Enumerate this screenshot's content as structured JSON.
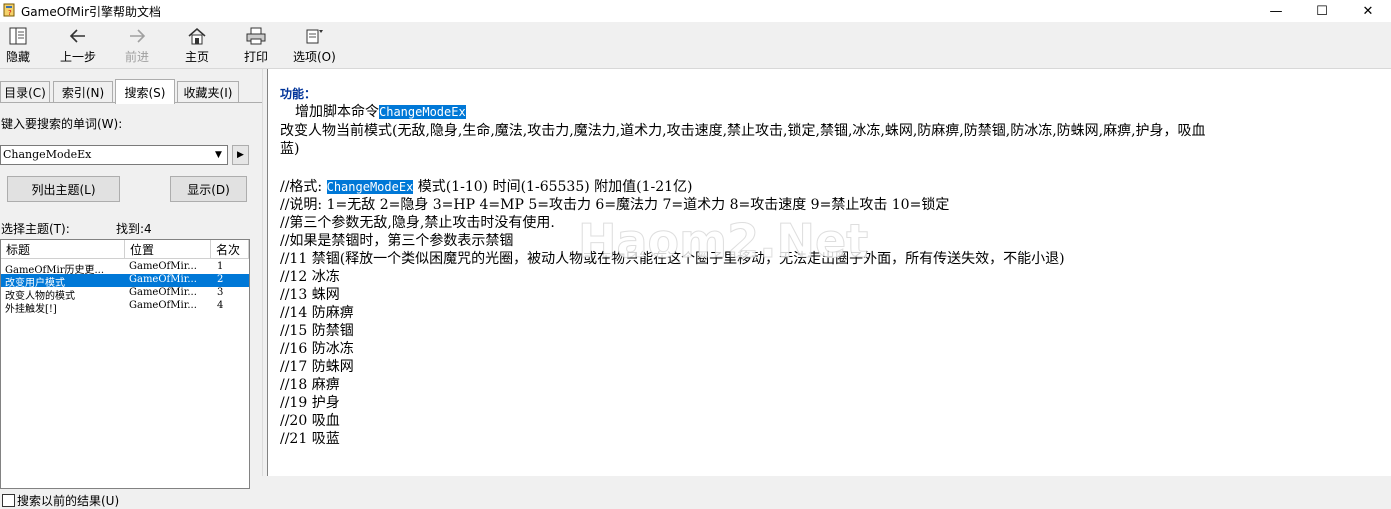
{
  "window": {
    "title": "GameOfMir引擎帮助文档",
    "min": "—",
    "max": "☐",
    "close": "✕"
  },
  "toolbar": {
    "hide": "隐藏",
    "back": "上一步",
    "forward": "前进",
    "home": "主页",
    "print": "打印",
    "options": "选项(O)"
  },
  "tabs": [
    {
      "label": "目录(C)"
    },
    {
      "label": "索引(N)"
    },
    {
      "label": "搜索(S)"
    },
    {
      "label": "收藏夹(I)"
    }
  ],
  "search": {
    "prompt": "键入要搜索的单词(W):",
    "value": "ChangeModeEx",
    "list_topics_button": "列出主题(L)",
    "display_button": "显示(D)",
    "select_topic_label": "选择主题(T):",
    "found_label": "找到:4",
    "columns": [
      "标题",
      "位置",
      "名次"
    ],
    "results": [
      {
        "title": "GameOfMir历史更...",
        "location": "GameOfMir...",
        "rank": "1",
        "selected": false
      },
      {
        "title": "改变用户模式",
        "location": "GameOfMir...",
        "rank": "2",
        "selected": true
      },
      {
        "title": "改变人物的模式",
        "location": "GameOfMir...",
        "rank": "3",
        "selected": false
      },
      {
        "title": "外挂触发[!]",
        "location": "GameOfMir...",
        "rank": "4",
        "selected": false
      }
    ],
    "search_previous_label": "搜索以前的结果(U)"
  },
  "content": {
    "heading": "功能：",
    "intro_prefix": "增加脚本命令",
    "keyword": "ChangeModeEx",
    "desc_line1": "改变人物当前模式(无敌,隐身,生命,魔法,攻击力,魔法力,道术力,攻击速度,禁止攻击,锁定,禁锢,冰冻,蛛网,防麻痹,防禁锢,防冰冻,防蛛网,麻痹,护身，吸血",
    "desc_line2": "蓝)",
    "format_prefix": "//格式: ",
    "format_suffix": " 模式(1-10) 时间(1-65535) 附加值(1-21亿)",
    "lines": [
      "//说明: 1=无敌 2=隐身 3=HP 4=MP 5=攻击力 6=魔法力 7=道术力 8=攻击速度 9=禁止攻击 10=锁定",
      "//第三个参数无敌,隐身,禁止攻击时没有使用.",
      "//如果是禁锢时，第三个参数表示禁锢",
      "//11 禁锢(释放一个类似困魔咒的光圈，被动人物或在物只能在这个圈子里移动，无法走出圈子外面，所有传送失效，不能小退)",
      "//12 冰冻",
      "//13 蛛网",
      "//14 防麻痹",
      "//15 防禁锢",
      "//16 防冰冻",
      "//17 防蛛网",
      "//18 麻痹",
      "//19 护身",
      "//20 吸血",
      "//21 吸蓝"
    ],
    "watermark": "Haom2.Net"
  }
}
